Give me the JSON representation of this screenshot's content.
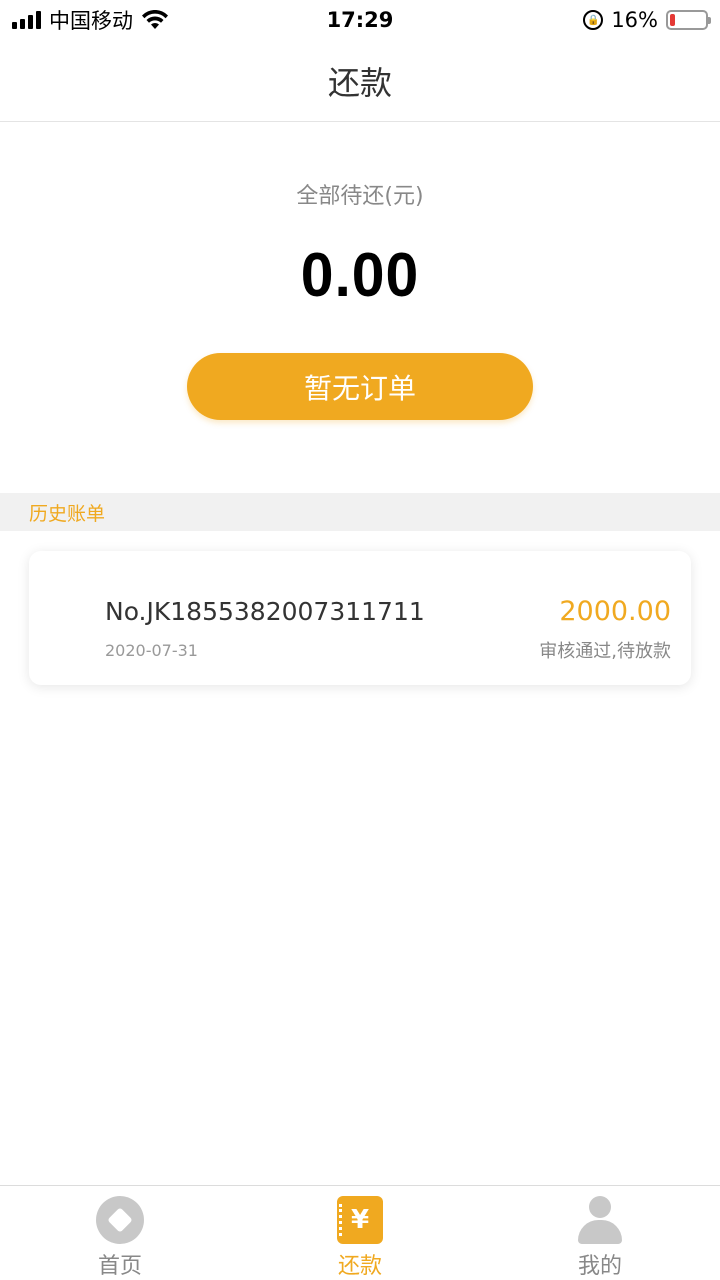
{
  "status_bar": {
    "carrier": "中国移动",
    "time": "17:29",
    "battery_percent": "16%",
    "battery_level": 0.16
  },
  "nav": {
    "title": "还款"
  },
  "summary": {
    "label": "全部待还(元)",
    "amount": "0.00",
    "button_label": "暂无订单"
  },
  "history": {
    "header": "历史账单",
    "bills": [
      {
        "number": "No.JK1855382007311711",
        "date": "2020-07-31",
        "amount": "2000.00",
        "status": "审核通过,待放款"
      }
    ]
  },
  "tabs": [
    {
      "label": "首页",
      "icon": "home-icon",
      "active": false
    },
    {
      "label": "还款",
      "icon": "repay-icon",
      "active": true
    },
    {
      "label": "我的",
      "icon": "user-icon",
      "active": false
    }
  ],
  "colors": {
    "accent": "#f0a920",
    "battery_low": "#e53935"
  }
}
